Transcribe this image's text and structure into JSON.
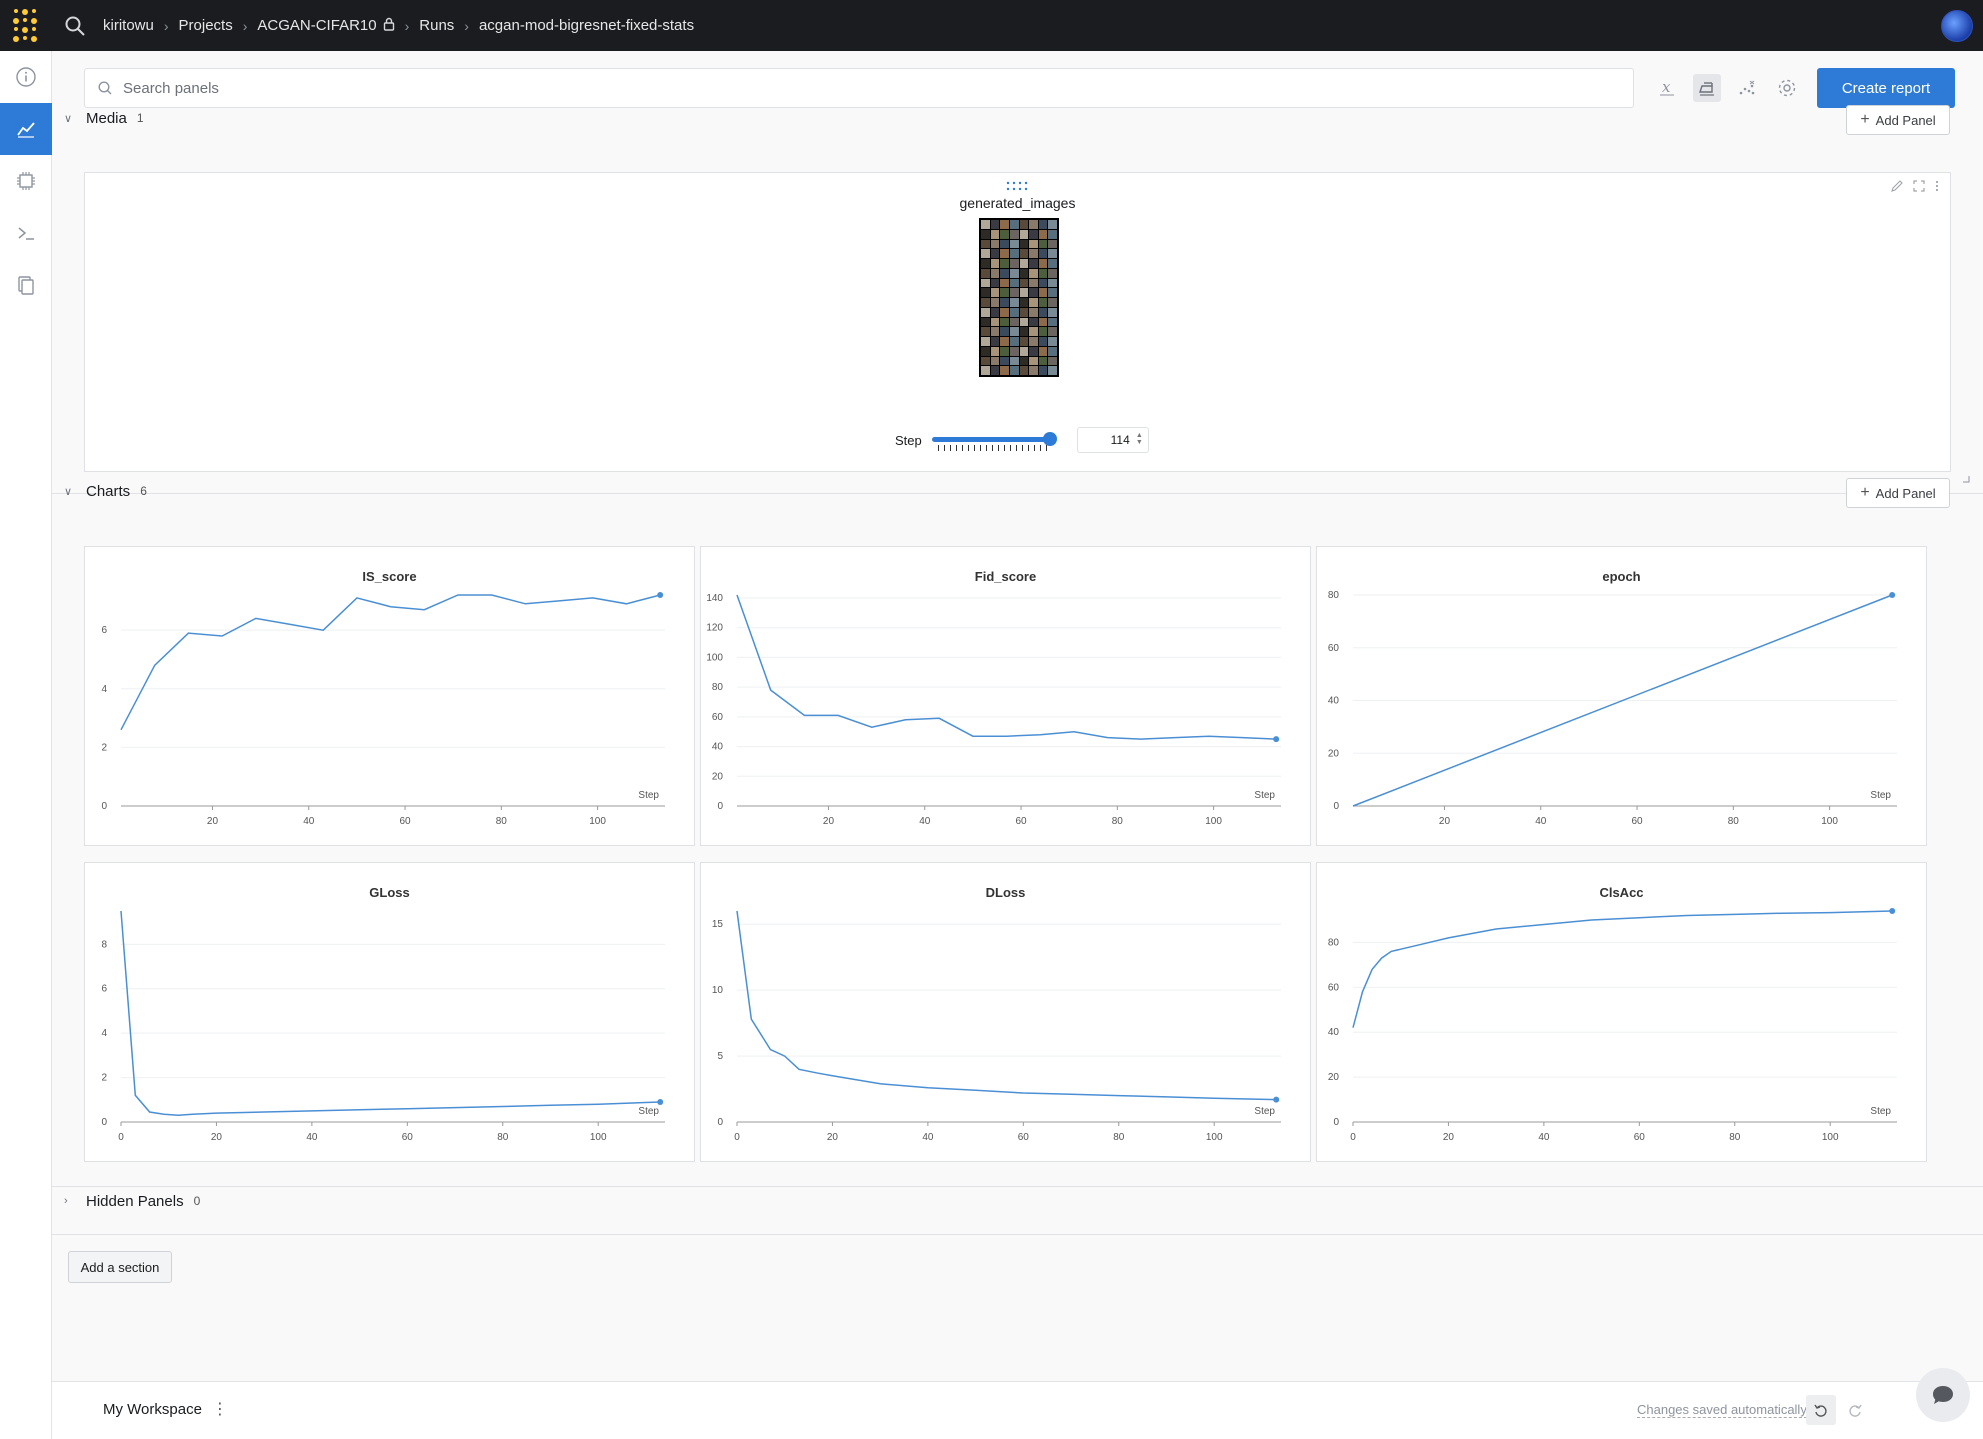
{
  "breadcrumb": {
    "user": "kiritowu",
    "projects": "Projects",
    "project": "ACGAN-CIFAR10",
    "runs": "Runs",
    "run": "acgan-mod-bigresnet-fixed-stats"
  },
  "toolbar": {
    "search_placeholder": "Search panels",
    "create_report": "Create report"
  },
  "media_section": {
    "title": "Media",
    "count": "1",
    "add_panel": "Add Panel",
    "panel_title": "generated_images",
    "step_label": "Step",
    "step_value": "114",
    "step_fraction": 1.0
  },
  "charts_section": {
    "title": "Charts",
    "count": "6",
    "add_panel": "Add Panel"
  },
  "hidden_section": {
    "title": "Hidden Panels",
    "count": "0"
  },
  "add_section_label": "Add a section",
  "footer": {
    "workspace": "My Workspace",
    "saved_status": "Changes saved automatically"
  },
  "colors": {
    "accent": "#2d7bd6",
    "line": "#4a8fd4",
    "topbar": "#1a1c1f",
    "logo": "#ffcc33"
  },
  "chart_data": [
    {
      "type": "line",
      "title": "IS_score",
      "xlabel": "Step",
      "ylabel": "",
      "xlim": [
        1,
        114
      ],
      "ylim": [
        0,
        7.2
      ],
      "xticks": [
        20,
        40,
        60,
        80,
        100
      ],
      "yticks": [
        0,
        2,
        4,
        6
      ],
      "x": [
        1,
        8,
        15,
        22,
        29,
        36,
        43,
        50,
        57,
        64,
        71,
        78,
        85,
        92,
        99,
        106,
        113
      ],
      "y": [
        2.6,
        4.8,
        5.9,
        5.8,
        6.4,
        6.2,
        6.0,
        7.1,
        6.8,
        6.7,
        7.2,
        7.2,
        6.9,
        7.0,
        7.1,
        6.9,
        7.2
      ]
    },
    {
      "type": "line",
      "title": "Fid_score",
      "xlabel": "Step",
      "ylabel": "",
      "xlim": [
        1,
        114
      ],
      "ylim": [
        0,
        142
      ],
      "xticks": [
        20,
        40,
        60,
        80,
        100
      ],
      "yticks": [
        0,
        20,
        40,
        60,
        80,
        100,
        120,
        140
      ],
      "x": [
        1,
        8,
        15,
        22,
        29,
        36,
        43,
        50,
        57,
        64,
        71,
        78,
        85,
        92,
        99,
        106,
        113
      ],
      "y": [
        142,
        78,
        61,
        61,
        53,
        58,
        59,
        47,
        47,
        48,
        50,
        46,
        45,
        46,
        47,
        46,
        45
      ]
    },
    {
      "type": "line",
      "title": "epoch",
      "xlabel": "Step",
      "ylabel": "",
      "xlim": [
        1,
        114
      ],
      "ylim": [
        0,
        80
      ],
      "xticks": [
        20,
        40,
        60,
        80,
        100
      ],
      "yticks": [
        0,
        20,
        40,
        60,
        80
      ],
      "x": [
        1,
        113
      ],
      "y": [
        0,
        80
      ]
    },
    {
      "type": "line",
      "title": "GLoss",
      "xlabel": "Step",
      "ylabel": "",
      "xlim": [
        0,
        114
      ],
      "ylim": [
        0,
        9.5
      ],
      "xticks": [
        0,
        20,
        40,
        60,
        80,
        100
      ],
      "yticks": [
        0,
        2,
        4,
        6,
        8
      ],
      "x": [
        0,
        3,
        6,
        9,
        12,
        15,
        20,
        30,
        40,
        50,
        60,
        70,
        80,
        90,
        100,
        113
      ],
      "y": [
        9.5,
        1.2,
        0.45,
        0.35,
        0.3,
        0.35,
        0.4,
        0.45,
        0.5,
        0.55,
        0.6,
        0.65,
        0.7,
        0.75,
        0.8,
        0.9
      ]
    },
    {
      "type": "line",
      "title": "DLoss",
      "xlabel": "Step",
      "ylabel": "",
      "xlim": [
        0,
        114
      ],
      "ylim": [
        0,
        16
      ],
      "xticks": [
        0,
        20,
        40,
        60,
        80,
        100
      ],
      "yticks": [
        0,
        5,
        10,
        15
      ],
      "x": [
        0,
        3,
        7,
        10,
        13,
        17,
        20,
        25,
        30,
        40,
        50,
        60,
        70,
        80,
        90,
        100,
        113
      ],
      "y": [
        16,
        7.8,
        5.5,
        5.0,
        4.0,
        3.7,
        3.5,
        3.2,
        2.9,
        2.6,
        2.4,
        2.2,
        2.1,
        2.0,
        1.9,
        1.8,
        1.7
      ]
    },
    {
      "type": "line",
      "title": "ClsAcc",
      "xlabel": "Step",
      "ylabel": "",
      "xlim": [
        0,
        114
      ],
      "ylim": [
        0,
        94
      ],
      "xticks": [
        0,
        20,
        40,
        60,
        80,
        100
      ],
      "yticks": [
        0,
        20,
        40,
        60,
        80
      ],
      "x": [
        0,
        2,
        4,
        6,
        8,
        10,
        14,
        20,
        30,
        40,
        50,
        60,
        70,
        80,
        90,
        100,
        113
      ],
      "y": [
        42,
        58,
        68,
        73,
        76,
        77,
        79,
        82,
        86,
        88,
        90,
        91,
        92,
        92.5,
        93,
        93.3,
        94
      ]
    }
  ]
}
